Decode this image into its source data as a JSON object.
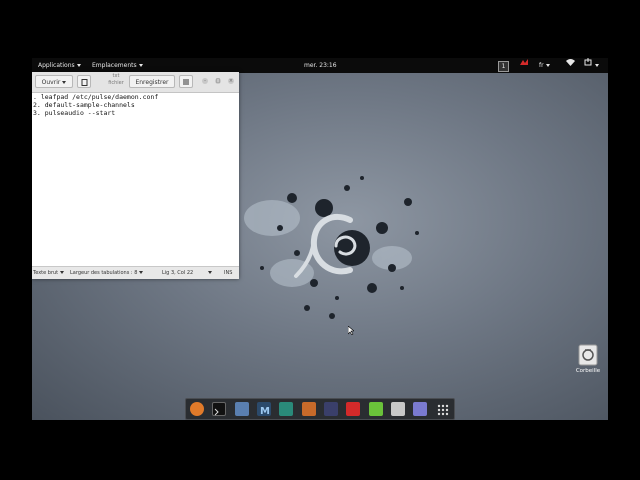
{
  "topbar": {
    "applications_label": "Applications",
    "places_label": "Emplacements",
    "clock": "mer. 23:16",
    "workspace_number": "1",
    "language": "fr"
  },
  "editor": {
    "open_label": "Ouvrir",
    "title_line1": "txt",
    "title_line2": "fichier",
    "save_label": "Enregistrer",
    "lines": [
      ". leafpad /etc/pulse/daemon.conf",
      "2. default-sample-channels",
      "3. pulseaudio --start"
    ],
    "status": {
      "syntax": "Texte brut",
      "tab_width": "Largeur des tabulations : 8",
      "position": "Lig 3, Col 22",
      "mode": "INS"
    }
  },
  "desktop": {
    "trash_label": "Corbeille"
  },
  "dock": {
    "icons": [
      "firefox-icon",
      "terminal-icon",
      "files-icon",
      "malwarebytes-icon",
      "hacker-tool-icon",
      "burpsuite-icon",
      "armitage-icon",
      "faraday-icon",
      "text-editor-icon",
      "screenshot-icon",
      "notes-icon",
      "app-grid-icon"
    ]
  },
  "colors": {
    "accent_red": "#d42a2a",
    "topbar_bg": "#0b0b0b",
    "dock_bg": "#2a2d31"
  }
}
